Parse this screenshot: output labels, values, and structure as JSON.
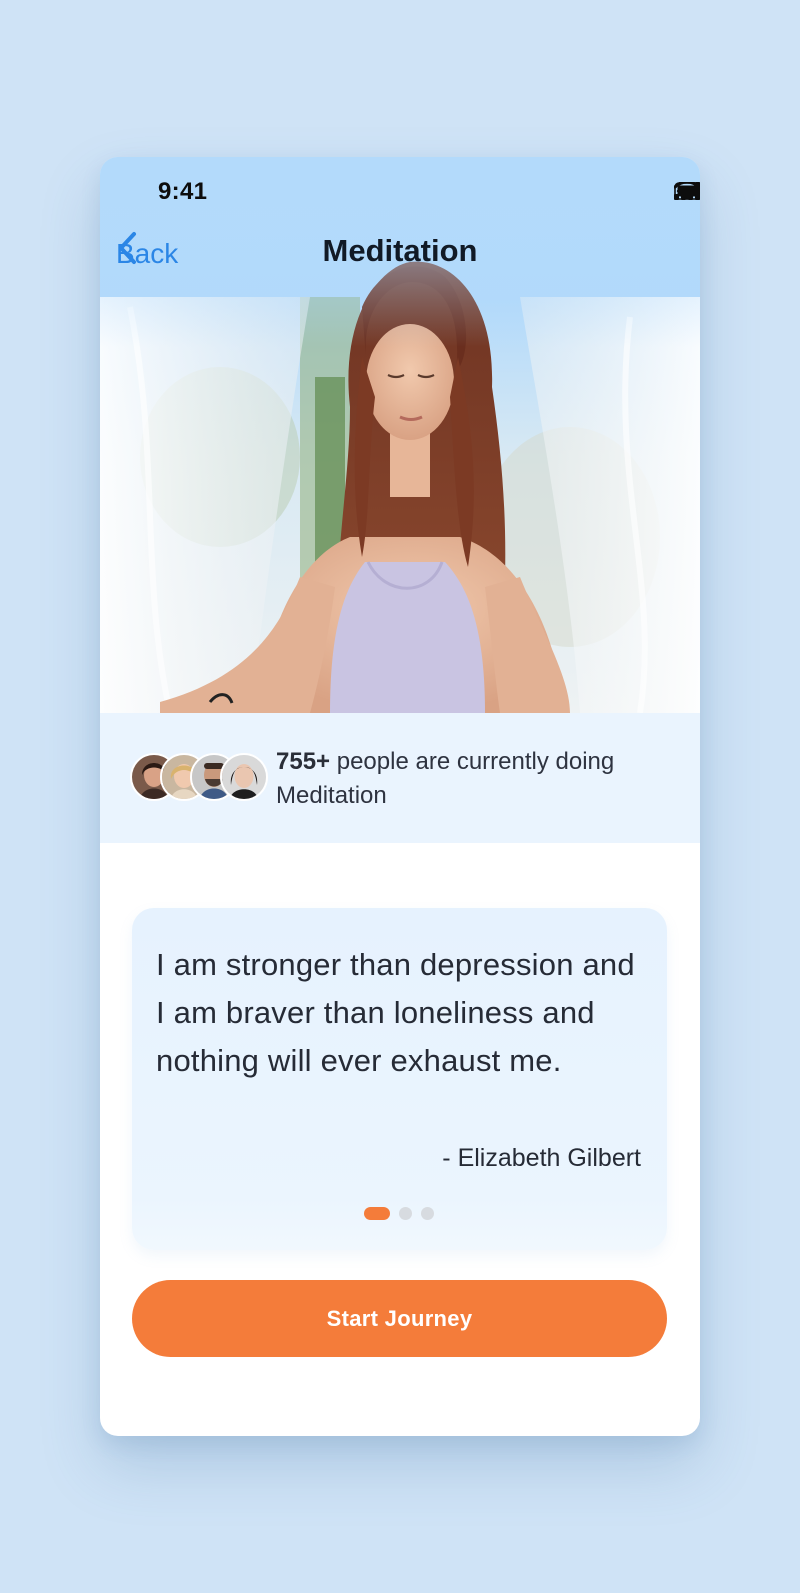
{
  "status_bar": {
    "time": "9:41"
  },
  "nav": {
    "back_label": "Back",
    "title": "Meditation"
  },
  "social_proof": {
    "count": "755+",
    "text": "people are currently doing Meditation",
    "avatars": [
      "avatar-1",
      "avatar-2",
      "avatar-3",
      "avatar-4"
    ]
  },
  "quote": {
    "text": "I am stronger than depression and I am braver than loneliness and nothing will ever exhaust me.",
    "author": "- Elizabeth Gilbert",
    "pagination": {
      "total": 3,
      "active": 1
    }
  },
  "cta": {
    "label": "Start Journey"
  },
  "colors": {
    "accent": "#f47c3a",
    "link": "#2b86e6",
    "header_bg": "#b5dcfc",
    "page_bg": "#cfe3f6"
  }
}
